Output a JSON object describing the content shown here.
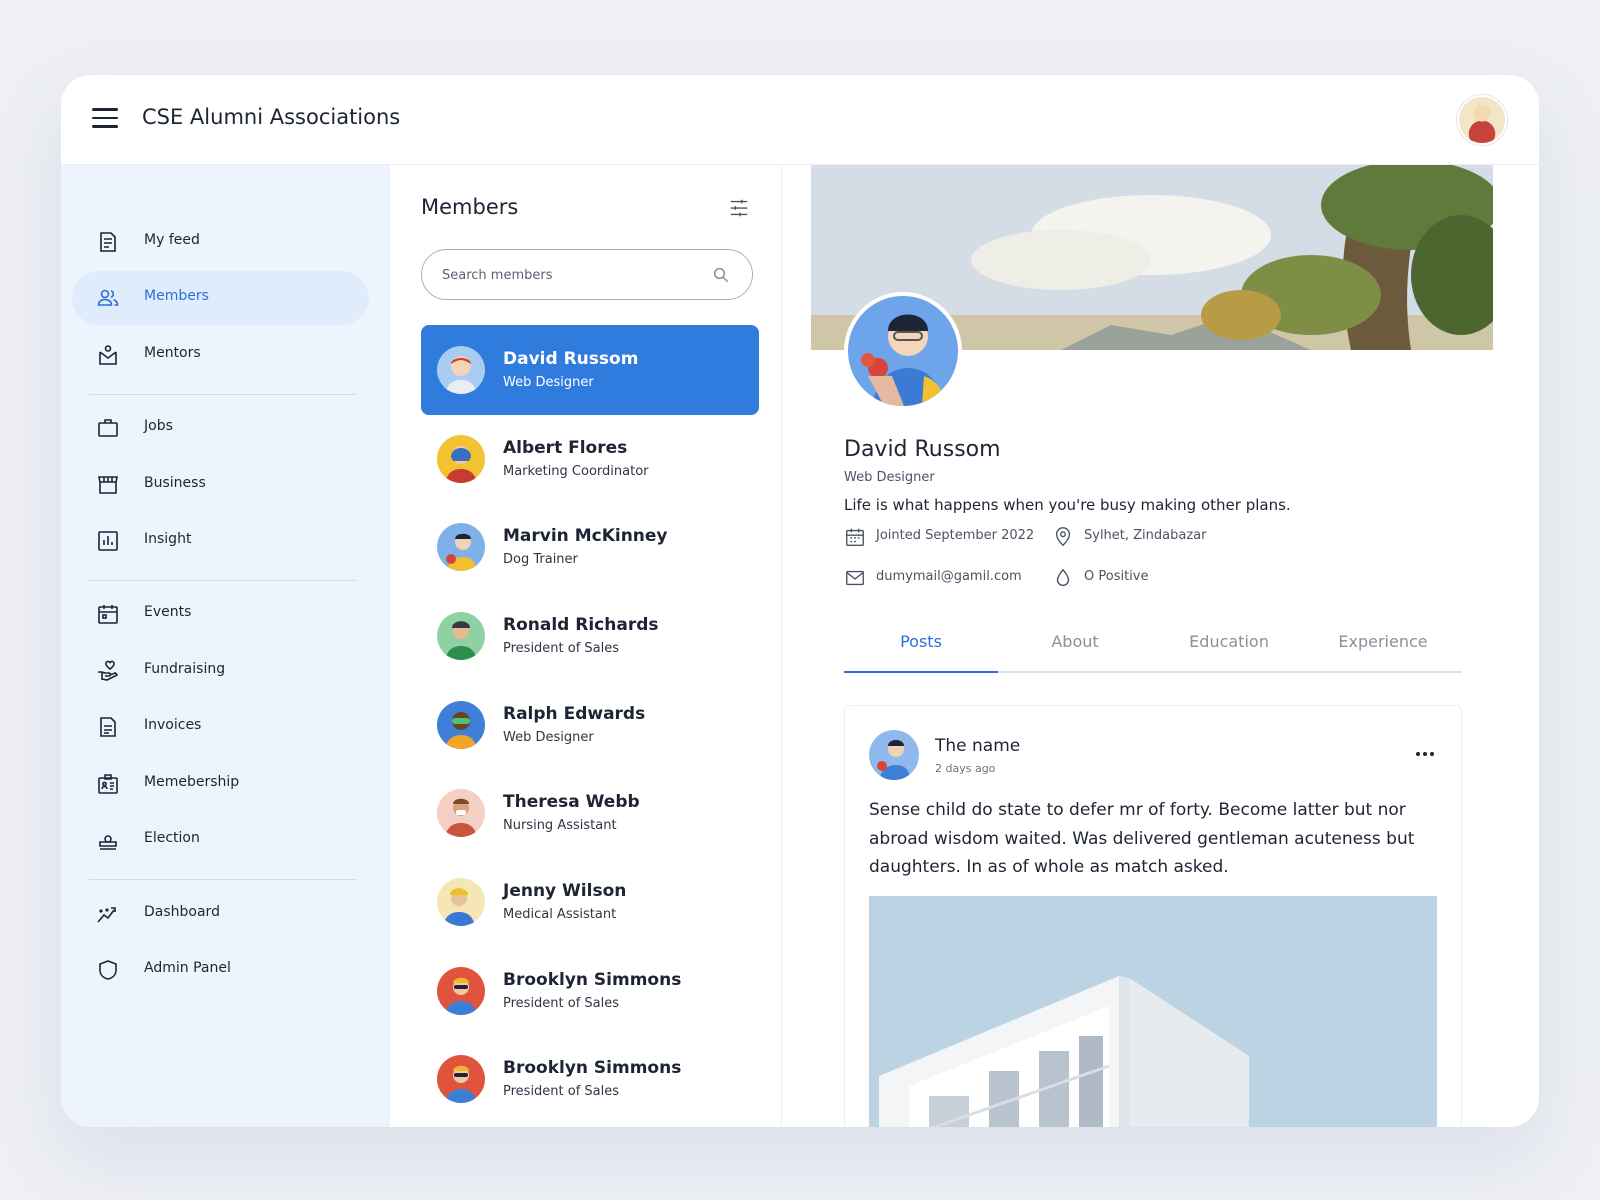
{
  "header": {
    "title": "CSE Alumni Associations"
  },
  "sidebar": {
    "items": [
      {
        "label": "My feed"
      },
      {
        "label": "Members"
      },
      {
        "label": "Mentors"
      },
      {
        "label": "Jobs"
      },
      {
        "label": "Business"
      },
      {
        "label": "Insight"
      },
      {
        "label": "Events"
      },
      {
        "label": "Fundraising"
      },
      {
        "label": "Invoices"
      },
      {
        "label": "Memebership"
      },
      {
        "label": "Election"
      },
      {
        "label": "Dashboard"
      },
      {
        "label": "Admin Panel"
      }
    ],
    "active": "Members"
  },
  "members": {
    "title": "Members",
    "search_placeholder": "Search members",
    "list": [
      {
        "name": "David Russom",
        "role": "Web Designer"
      },
      {
        "name": "Albert Flores",
        "role": "Marketing Coordinator"
      },
      {
        "name": "Marvin McKinney",
        "role": "Dog Trainer"
      },
      {
        "name": "Ronald Richards",
        "role": "President of Sales"
      },
      {
        "name": "Ralph Edwards",
        "role": "Web Designer"
      },
      {
        "name": "Theresa Webb",
        "role": "Nursing Assistant"
      },
      {
        "name": "Jenny Wilson",
        "role": "Medical Assistant"
      },
      {
        "name": "Brooklyn Simmons",
        "role": "President of Sales"
      },
      {
        "name": "Brooklyn Simmons",
        "role": "President of Sales"
      }
    ]
  },
  "profile": {
    "name": "David Russom",
    "role": "Web Designer",
    "bio": "Life is what happens when you're busy making other plans.",
    "joined": "Jointed September 2022",
    "location": "Sylhet, Zindabazar",
    "email": "dumymail@gamil.com",
    "blood": "O Positive",
    "tabs": [
      "Posts",
      "About",
      "Education",
      "Experience"
    ],
    "active_tab": "Posts"
  },
  "post": {
    "author": "The name",
    "time": "2 days ago",
    "text": "Sense child do state to defer mr of forty. Become latter but nor abroad wisdom waited. Was delivered gentleman acuteness but daughters. In as of whole as match asked."
  },
  "colors": {
    "accent": "#2f7bde",
    "sidebar_bg": "#eef4fd",
    "active_nav_bg": "#e0ebfb",
    "text": "#1d2433"
  }
}
